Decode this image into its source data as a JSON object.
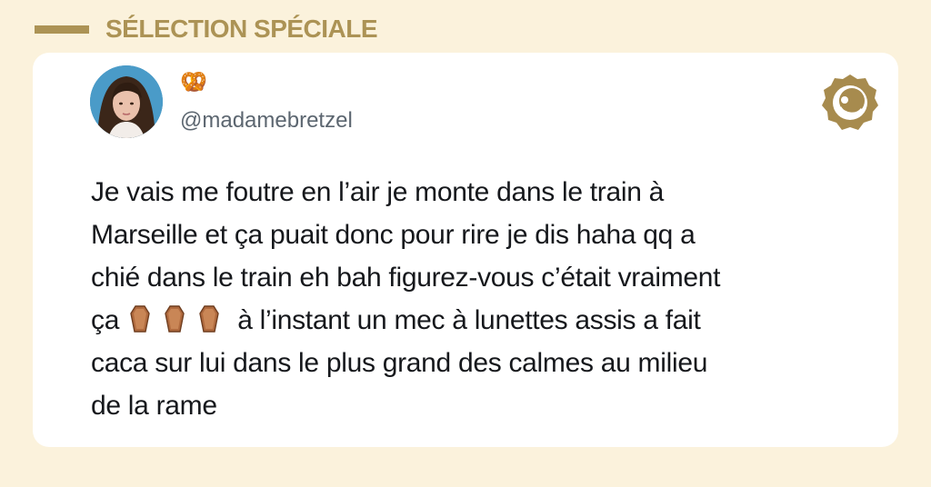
{
  "section": {
    "title": "SÉLECTION SPÉCIALE"
  },
  "tweet": {
    "display_name_icon": "pretzel-icon",
    "display_name_emoji": "🥨",
    "handle": "@madamebretzel",
    "avatar_icon": "avatar",
    "brand_icon": "brand-logo-icon",
    "text_lines": [
      "Je vais me foutre en l’air je monte dans le train à",
      "Marseille et ça puait donc pour rire je dis haha qq a",
      "chié dans le train eh bah figurez-vous c’était vraiment",
      "ça",
      "à l’instant un mec à lunettes assis a fait",
      "caca sur lui dans le plus grand des calmes au milieu",
      "de la rame"
    ],
    "inline_emojis": [
      "coffin-icon",
      "coffin-icon",
      "coffin-icon"
    ]
  },
  "colors": {
    "background": "#fbf2dc",
    "accent": "#ac9355",
    "card": "#ffffff",
    "text": "#16181c",
    "handle": "#5c6670"
  }
}
